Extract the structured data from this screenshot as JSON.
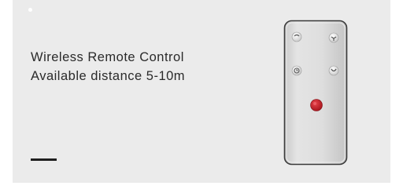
{
  "feature": {
    "line1": "Wireless Remote Control",
    "line2": "Available distance 5-10m"
  },
  "colors": {
    "panel_background": "#ebebeb",
    "text": "#2a2a2a",
    "accent_bar": "#1f1f1f",
    "remote_body": "#d9d9d9",
    "power_button": "#c41a22"
  },
  "remote": {
    "icons": [
      "light-icon",
      "fan-icon",
      "timer-icon",
      "swing-icon",
      "power-icon"
    ]
  }
}
